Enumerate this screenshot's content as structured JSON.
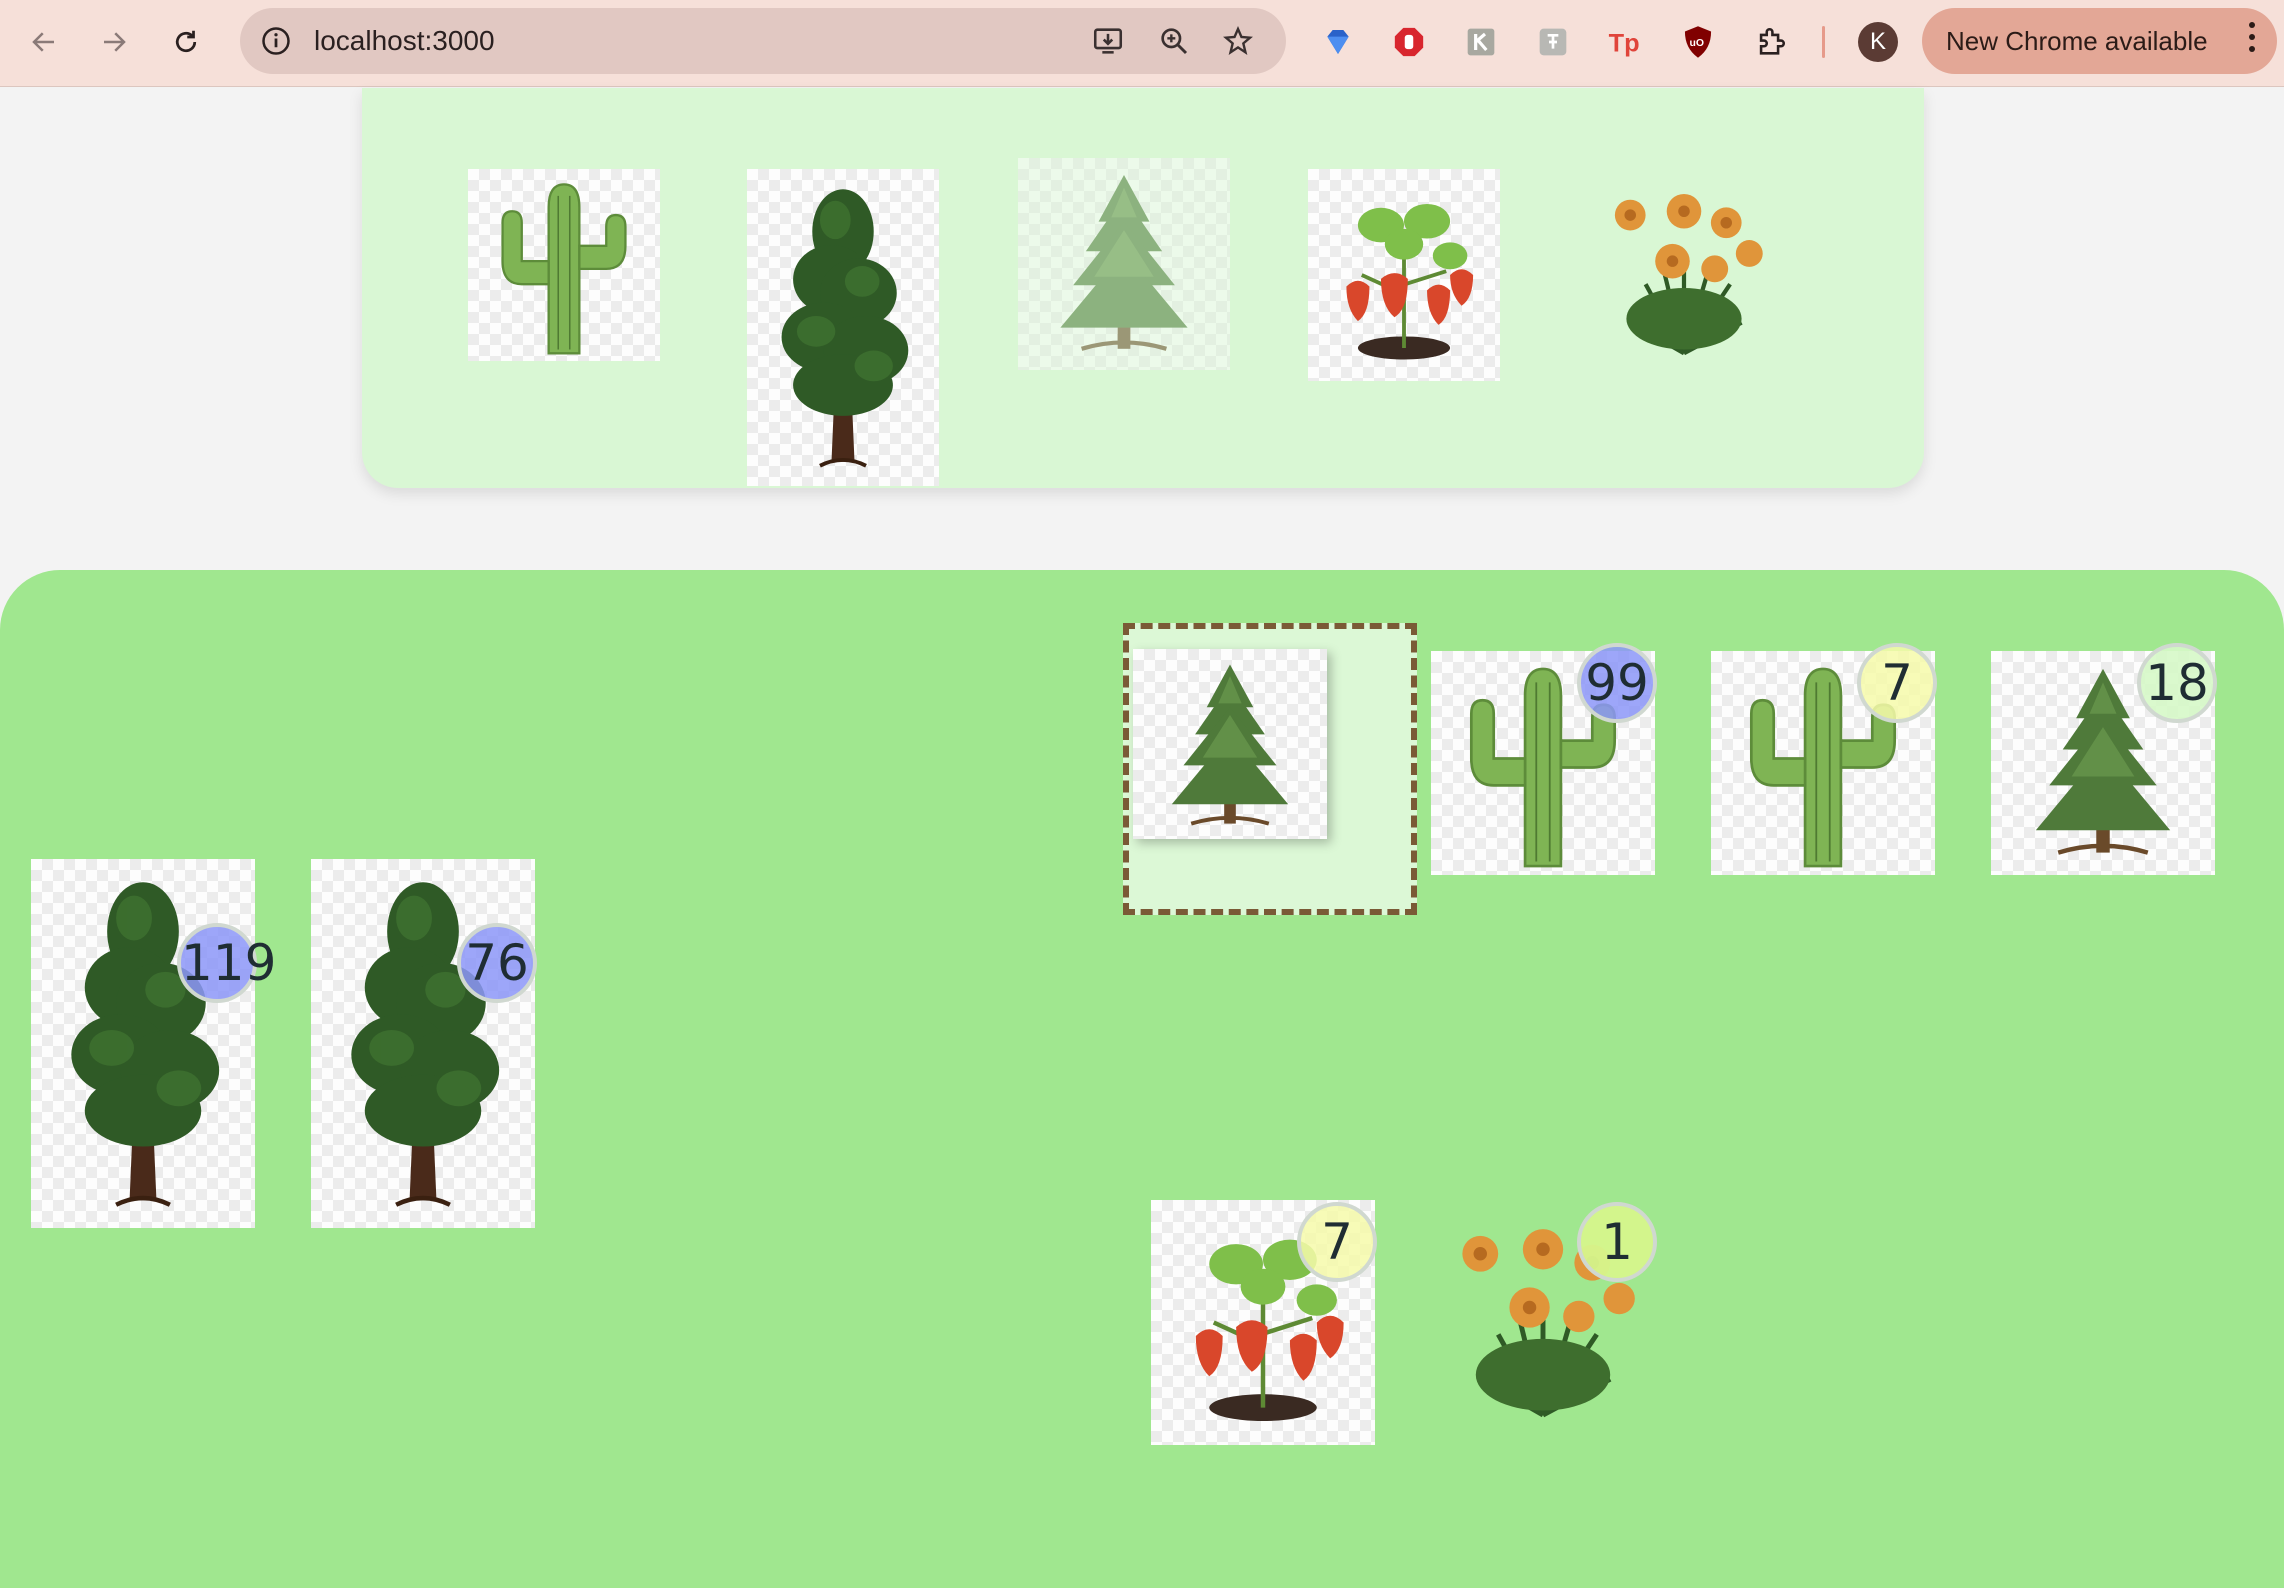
{
  "browser": {
    "url": "localhost:3000",
    "update_label": "New Chrome available",
    "profile_initial": "K",
    "icons": {
      "back": "arrow-left-icon",
      "forward": "arrow-right-icon",
      "reload": "reload-icon",
      "site_info": "info-icon",
      "install": "install-app-icon",
      "zoom": "zoom-icon",
      "bookmark": "star-icon",
      "extensions": "puzzle-icon",
      "menu": "kebab-menu-icon"
    },
    "extensions": [
      "gem-extension-icon",
      "stop-hand-extension-icon",
      "k-extension-icon",
      "translate-extension-icon",
      "tp-extension-icon",
      "ublock-extension-icon"
    ]
  },
  "palette": {
    "items": [
      {
        "plant": "cactus",
        "selected": false
      },
      {
        "plant": "sequoia",
        "selected": false
      },
      {
        "plant": "pine",
        "selected": true
      },
      {
        "plant": "strawberry",
        "selected": false
      },
      {
        "plant": "marigold",
        "selected": false
      }
    ]
  },
  "garden": {
    "plants": [
      {
        "plant": "cactus",
        "count": "99",
        "badge_color": "#8c96f8"
      },
      {
        "plant": "cactus",
        "count": "7",
        "badge_color": "#f6faaa"
      },
      {
        "plant": "pine",
        "count": "18",
        "badge_color": "#d6f8c8"
      },
      {
        "plant": "sequoia",
        "count": "119",
        "badge_color": "#8c96f8"
      },
      {
        "plant": "sequoia",
        "count": "76",
        "badge_color": "#8c96f8"
      },
      {
        "plant": "strawberry",
        "count": "7",
        "badge_color": "#f6faaa"
      },
      {
        "plant": "marigold",
        "count": "1",
        "badge_color": "#d6f68c"
      }
    ],
    "dragging": {
      "plant": "pine"
    }
  },
  "colors": {
    "toolbar": "#f6e0d9",
    "palette_bg": "#d9f7d4",
    "garden_bg": "#a0e78f",
    "dropzone_border": "#7a5a36"
  }
}
